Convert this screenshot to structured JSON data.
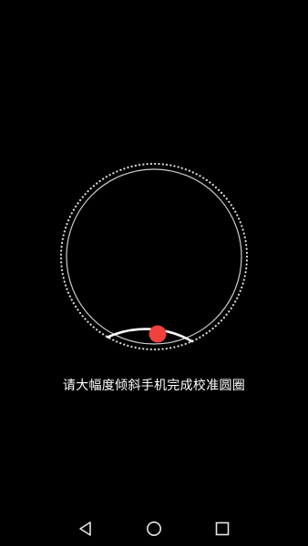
{
  "calibration": {
    "instruction": "请大幅度倾斜手机完成校准圆圈",
    "progress_fraction": 0.15,
    "colors": {
      "ring": "#d9d9d9",
      "progress": "#ffffff",
      "ball": "#f0413c",
      "background": "#000000"
    }
  },
  "navbar": {
    "back_icon": "back-triangle-icon",
    "home_icon": "home-circle-icon",
    "recent_icon": "recent-square-icon"
  }
}
